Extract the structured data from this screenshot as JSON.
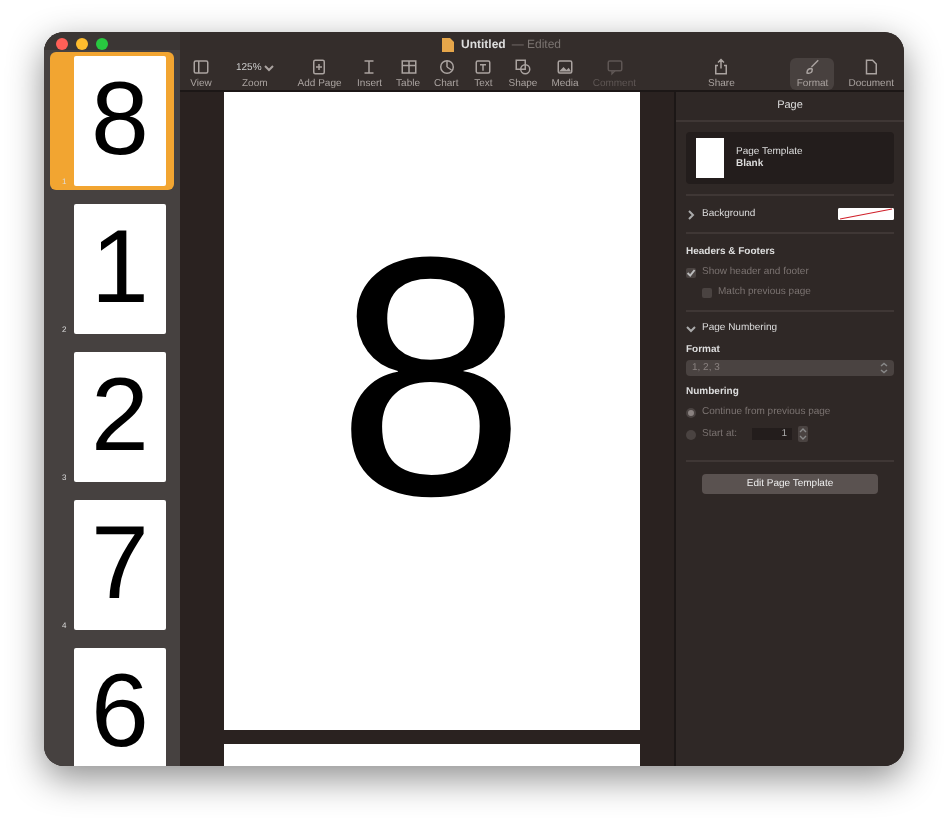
{
  "window": {
    "title": "Untitled",
    "status": "— Edited"
  },
  "toolbar": [
    {
      "kind": "view",
      "label": "View",
      "selected": false,
      "disabled": false
    },
    {
      "kind": "zoom",
      "label": "Zoom",
      "value": "125%",
      "selected": false,
      "disabled": false
    },
    {
      "kind": "add-page",
      "label": "Add Page",
      "selected": false,
      "disabled": false
    },
    {
      "kind": "insert",
      "label": "Insert",
      "selected": false,
      "disabled": false
    },
    {
      "kind": "table",
      "label": "Table",
      "selected": false,
      "disabled": false
    },
    {
      "kind": "chart",
      "label": "Chart",
      "selected": false,
      "disabled": false
    },
    {
      "kind": "text",
      "label": "Text",
      "selected": false,
      "disabled": false
    },
    {
      "kind": "shape",
      "label": "Shape",
      "selected": false,
      "disabled": false
    },
    {
      "kind": "media",
      "label": "Media",
      "selected": false,
      "disabled": false
    },
    {
      "kind": "comment",
      "label": "Comment",
      "selected": false,
      "disabled": true
    },
    {
      "kind": "share",
      "label": "Share",
      "selected": false,
      "disabled": false
    },
    {
      "kind": "format",
      "label": "Format",
      "selected": true,
      "disabled": false
    },
    {
      "kind": "document",
      "label": "Document",
      "selected": false,
      "disabled": false
    }
  ],
  "thumbnails": [
    {
      "number": "1",
      "digit": "8",
      "selected": true
    },
    {
      "number": "2",
      "digit": "1",
      "selected": false
    },
    {
      "number": "3",
      "digit": "2",
      "selected": false
    },
    {
      "number": "4",
      "digit": "7",
      "selected": false
    },
    {
      "digit": "6",
      "selected": false
    }
  ],
  "canvas": {
    "page_digit": "8"
  },
  "inspector": {
    "title": "Page",
    "template": {
      "title": "Page Template",
      "name": "Blank"
    },
    "background": {
      "label": "Background",
      "expanded": false
    },
    "headers_footers": {
      "title": "Headers & Footers",
      "options": [
        {
          "label": "Show header and footer",
          "checked": true,
          "disabled": true
        },
        {
          "label": "Match previous page",
          "checked": false,
          "disabled": true
        }
      ]
    },
    "page_numbering": {
      "label": "Page Numbering",
      "expanded": true,
      "format_label": "Format",
      "format_value": "1, 2, 3",
      "numbering_label": "Numbering",
      "choices": [
        {
          "label": "Continue from previous page",
          "selected": true
        },
        {
          "label": "Start at:",
          "selected": false,
          "value": "1"
        }
      ]
    },
    "edit_button": "Edit Page Template"
  }
}
